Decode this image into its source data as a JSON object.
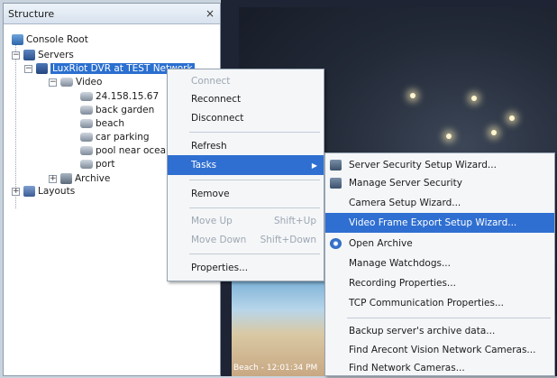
{
  "panel": {
    "title": "Structure",
    "close": "×"
  },
  "tree": {
    "console_root": "Console Root",
    "servers": "Servers",
    "server": "LuxRiot DVR at TEST Network",
    "video": "Video",
    "cameras": [
      "24.158.15.67",
      "back garden",
      "beach",
      "car parking",
      "pool near ocean",
      "port"
    ],
    "archive": "Archive",
    "layouts": "Layouts"
  },
  "context_menu": {
    "items": [
      "Connect",
      "Reconnect",
      "Disconnect",
      "Refresh",
      "Tasks",
      "Remove",
      "Move Up",
      "Move Down",
      "Properties..."
    ],
    "shortcuts": {
      "move_up": "Shift+Up",
      "move_down": "Shift+Down"
    }
  },
  "submenu": {
    "items": [
      "Server Security Setup Wizard...",
      "Manage Server Security",
      "Camera Setup Wizard...",
      "Video Frame Export Setup Wizard...",
      "Open Archive",
      "Manage Watchdogs...",
      "Recording Properties...",
      "TCP Communication Properties...",
      "Backup server's archive data...",
      "Find Arecont Vision Network Cameras...",
      "Find Network Cameras..."
    ]
  },
  "thumbnail": {
    "caption": "Beach - 12:01:34 PM"
  },
  "colors": {
    "highlight": "#2f6fd1",
    "selection": "#2b6fd0",
    "menu_bg": "#f4f6f8"
  },
  "icons": {
    "close": "close-icon",
    "tasks_arrow": "chevron-right-icon"
  }
}
